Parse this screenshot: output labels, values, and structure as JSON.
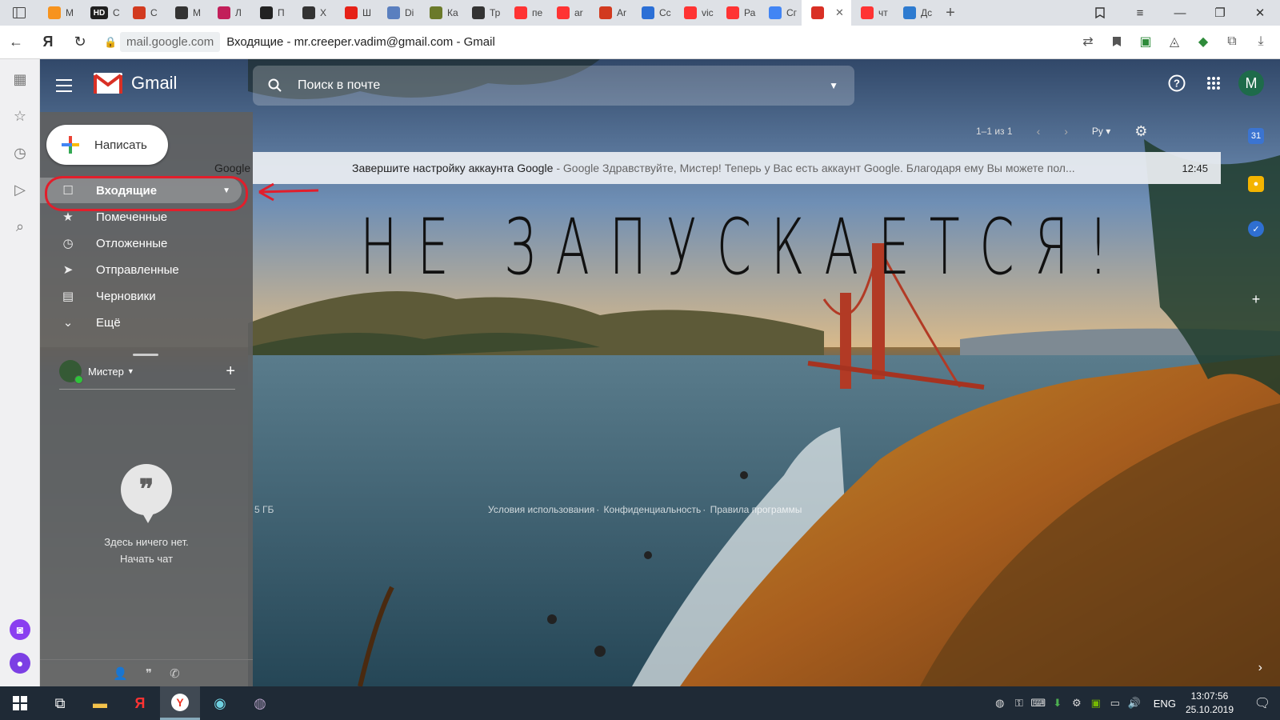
{
  "browser": {
    "tabs": [
      {
        "abbr": "M",
        "fav": "ok-icon",
        "color": "#f7931e"
      },
      {
        "abbr": "C",
        "fav": "hd-icon",
        "color": "#1f1f1f",
        "text": "HD"
      },
      {
        "abbr": "C",
        "fav": "red-circle-icon",
        "color": "#d23a1f"
      },
      {
        "abbr": "M",
        "fav": "avatar-icon",
        "color": "#333333"
      },
      {
        "abbr": "Л",
        "fav": "u-icon",
        "color": "#c21f5a"
      },
      {
        "abbr": "П",
        "fav": "bird-icon",
        "color": "#222222"
      },
      {
        "abbr": "Х",
        "fav": "avatar-icon",
        "color": "#333333"
      },
      {
        "abbr": "Ш",
        "fav": "youtube-icon",
        "color": "#e62117"
      },
      {
        "abbr": "Di",
        "fav": "doc-icon",
        "color": "#5a7fbf"
      },
      {
        "abbr": "Ка",
        "fav": "game-icon",
        "color": "#6b7a2a"
      },
      {
        "abbr": "Тр",
        "fav": "avatar-icon",
        "color": "#333333"
      },
      {
        "abbr": "пе",
        "fav": "yandex-icon",
        "color": "#f33"
      },
      {
        "abbr": "ar",
        "fav": "yandex-icon",
        "color": "#f33"
      },
      {
        "abbr": "Ar",
        "fav": "red-circle-icon",
        "color": "#d23a1f"
      },
      {
        "abbr": "Cc",
        "fav": "chat-icon",
        "color": "#2b6fd6"
      },
      {
        "abbr": "vic",
        "fav": "yandex-icon",
        "color": "#f33"
      },
      {
        "abbr": "Ра",
        "fav": "y-icon",
        "color": "#f33"
      },
      {
        "abbr": "Сг",
        "fav": "google-icon",
        "color": "#4285f4"
      },
      {
        "abbr": "",
        "fav": "gmail-icon",
        "color": "#d93025",
        "active": true
      },
      {
        "abbr": "чт",
        "fav": "yandex-icon",
        "color": "#f33"
      },
      {
        "abbr": "Дс",
        "fav": "translate-icon",
        "color": "#2e7bd0"
      }
    ],
    "url_domain": "mail.google.com",
    "url_title": "Входящие - mr.creeper.vadim@gmail.com - Gmail"
  },
  "gmail": {
    "logo_text": "Gmail",
    "search_placeholder": "Поиск в почте",
    "avatar_letter": "M",
    "compose_label": "Написать",
    "nav": [
      {
        "label": "Входящие",
        "icon": "inbox-icon",
        "active": true
      },
      {
        "label": "Помеченные",
        "icon": "star-icon"
      },
      {
        "label": "Отложенные",
        "icon": "clock-icon"
      },
      {
        "label": "Отправленные",
        "icon": "send-icon"
      },
      {
        "label": "Черновики",
        "icon": "draft-icon"
      },
      {
        "label": "Ещё",
        "icon": "chevron-down-icon"
      }
    ],
    "hangouts_user": "Мистер",
    "empty_chat_text": "Здесь ничего нет.",
    "start_chat_link": "Начать чат",
    "pagination": "1–1 из 1",
    "input_tool": "Ру",
    "email": {
      "sender": "Google",
      "subject": "Завершите настройку аккаунта Google",
      "snippet": " - Google Здравствуйте, Мистер! Теперь у Вас есть аккаунт Google. Благодаря ему Вы можете пол...",
      "time": "12:45"
    },
    "storage": "5 ГБ",
    "footer_links": [
      "Условия использования",
      "Конфиденциальность",
      "Правила программы"
    ],
    "annotation_text": "НЕ ЗАПУСКАЕТСЯ!"
  },
  "taskbar": {
    "lang": "ENG",
    "time": "13:07:56",
    "date": "25.10.2019"
  },
  "colors": {
    "annotation": "#e21e2b",
    "nav_bg": "#5f5f5f",
    "taskbar_bg": "#1f2a36"
  }
}
